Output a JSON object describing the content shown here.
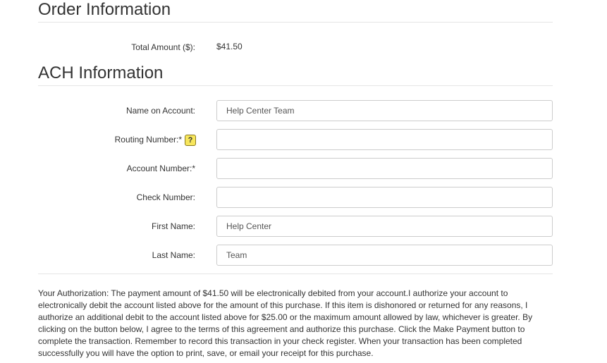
{
  "order_section": {
    "title": "Order Information",
    "total_label": "Total Amount ($):",
    "total_value": "$41.50"
  },
  "ach_section": {
    "title": "ACH Information",
    "fields": {
      "name_on_account": {
        "label": "Name on Account:",
        "value": "Help Center Team"
      },
      "routing_number": {
        "label": "Routing Number:*",
        "value": "",
        "help_icon": "?"
      },
      "account_number": {
        "label": "Account Number:*",
        "value": ""
      },
      "check_number": {
        "label": "Check Number:",
        "value": ""
      },
      "first_name": {
        "label": "First Name:",
        "value": "Help Center"
      },
      "last_name": {
        "label": "Last Name:",
        "value": "Team"
      }
    }
  },
  "authorization": {
    "text": "Your Authorization: The payment amount of $41.50 will be electronically debited from your account.I authorize your account to electronically debit the account listed above for the amount of this purchase. If this item is dishonored or returned for any reasons, I authorize an additional debit to the account listed above for $25.00 or the maximum amount allowed by law, whichever is greater. By clicking on the button below, I agree to the terms of this agreement and authorize this purchase. Click the Make Payment button to complete the transaction. Remember to record this transaction in your check register. When your transaction has been completed successfully you will have the option to print, save, or email your receipt for this purchase."
  },
  "colors": {
    "help_icon_bg": "#f7e65c",
    "rule": "#e5e5e5",
    "field_border": "#cccccc"
  },
  "icons": {
    "help": "question-mark-help-icon"
  }
}
